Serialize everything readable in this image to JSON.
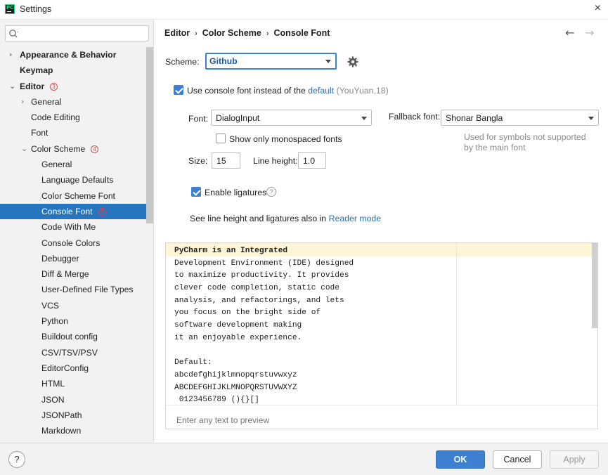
{
  "window": {
    "title": "Settings",
    "close_glyph": "×"
  },
  "sidebar": {
    "search": {
      "value": "",
      "placeholder": ""
    },
    "items": [
      {
        "label": "Appearance & Behavior",
        "level": 0,
        "arrow": "›",
        "bold": true,
        "badge": ""
      },
      {
        "label": "Keymap",
        "level": 0,
        "arrow": "",
        "bold": true,
        "badge": ""
      },
      {
        "label": "Editor",
        "level": 0,
        "arrow": "⌄",
        "bold": true,
        "badge": "3"
      },
      {
        "label": "General",
        "level": 1,
        "arrow": "›",
        "bold": false,
        "badge": ""
      },
      {
        "label": "Code Editing",
        "level": 1,
        "arrow": "",
        "bold": false,
        "badge": ""
      },
      {
        "label": "Font",
        "level": 1,
        "arrow": "",
        "bold": false,
        "badge": ""
      },
      {
        "label": "Color Scheme",
        "level": 1,
        "arrow": "⌄",
        "bold": false,
        "badge": "4"
      },
      {
        "label": "General",
        "level": 2,
        "arrow": "",
        "bold": false,
        "badge": ""
      },
      {
        "label": "Language Defaults",
        "level": 2,
        "arrow": "",
        "bold": false,
        "badge": ""
      },
      {
        "label": "Color Scheme Font",
        "level": 2,
        "arrow": "",
        "bold": false,
        "badge": ""
      },
      {
        "label": "Console Font",
        "level": 2,
        "arrow": "",
        "bold": false,
        "badge": "5",
        "selected": true
      },
      {
        "label": "Code With Me",
        "level": 2,
        "arrow": "",
        "bold": false,
        "badge": ""
      },
      {
        "label": "Console Colors",
        "level": 2,
        "arrow": "",
        "bold": false,
        "badge": ""
      },
      {
        "label": "Debugger",
        "level": 2,
        "arrow": "",
        "bold": false,
        "badge": ""
      },
      {
        "label": "Diff & Merge",
        "level": 2,
        "arrow": "",
        "bold": false,
        "badge": ""
      },
      {
        "label": "User-Defined File Types",
        "level": 2,
        "arrow": "",
        "bold": false,
        "badge": ""
      },
      {
        "label": "VCS",
        "level": 2,
        "arrow": "",
        "bold": false,
        "badge": ""
      },
      {
        "label": "Python",
        "level": 2,
        "arrow": "",
        "bold": false,
        "badge": ""
      },
      {
        "label": "Buildout config",
        "level": 2,
        "arrow": "",
        "bold": false,
        "badge": ""
      },
      {
        "label": "CSV/TSV/PSV",
        "level": 2,
        "arrow": "",
        "bold": false,
        "badge": ""
      },
      {
        "label": "EditorConfig",
        "level": 2,
        "arrow": "",
        "bold": false,
        "badge": ""
      },
      {
        "label": "HTML",
        "level": 2,
        "arrow": "",
        "bold": false,
        "badge": ""
      },
      {
        "label": "JSON",
        "level": 2,
        "arrow": "",
        "bold": false,
        "badge": ""
      },
      {
        "label": "JSONPath",
        "level": 2,
        "arrow": "",
        "bold": false,
        "badge": ""
      },
      {
        "label": "Markdown",
        "level": 2,
        "arrow": "",
        "bold": false,
        "badge": ""
      }
    ]
  },
  "header": {
    "breadcrumb": [
      "Editor",
      "Color Scheme",
      "Console Font"
    ],
    "separator": "›",
    "back_glyph": "←",
    "forward_glyph": "→"
  },
  "scheme": {
    "label": "Scheme:",
    "value": "Github"
  },
  "use_console_font": {
    "checked": true,
    "label": "Use console font instead of the",
    "link": "default",
    "suffix": "(YouYuan,18)"
  },
  "font": {
    "label": "Font:",
    "value": "DialogInput",
    "monospaced_label": "Show only monospaced fonts",
    "monospaced_checked": false
  },
  "fallback": {
    "label": "Fallback font:",
    "value": "Shonar Bangla",
    "note_line1": "Used for symbols not supported",
    "note_line2": "by the main font"
  },
  "size": {
    "label": "Size:",
    "value": "15"
  },
  "line_height": {
    "label": "Line height:",
    "value": "1.0"
  },
  "ligatures": {
    "label": "Enable ligatures",
    "checked": true,
    "help": "?"
  },
  "reader": {
    "text": "See line height and ligatures also in",
    "link": "Reader mode"
  },
  "preview": {
    "lines": [
      "PyCharm is an Integrated",
      "Development Environment (IDE) designed",
      "to maximize productivity. It provides",
      "clever code completion, static code",
      "analysis, and refactorings, and lets",
      "you focus on the bright side of",
      "software development making",
      "it an enjoyable experience.",
      "",
      "Default:",
      "abcdefghijklmnopqrstuvwxyz",
      "ABCDEFGHIJKLMNOPQRSTUVWXYZ",
      " 0123456789 (){}[]"
    ],
    "placeholder": "Enter any text to preview"
  },
  "footer": {
    "help": "?",
    "ok": "OK",
    "cancel": "Cancel",
    "apply": "Apply"
  },
  "colors": {
    "accent": "#3d7fd1",
    "selection": "#2675bf",
    "link": "#2470b3",
    "badge": "#e0454b",
    "preview_highlight": "#fcf5d6"
  }
}
